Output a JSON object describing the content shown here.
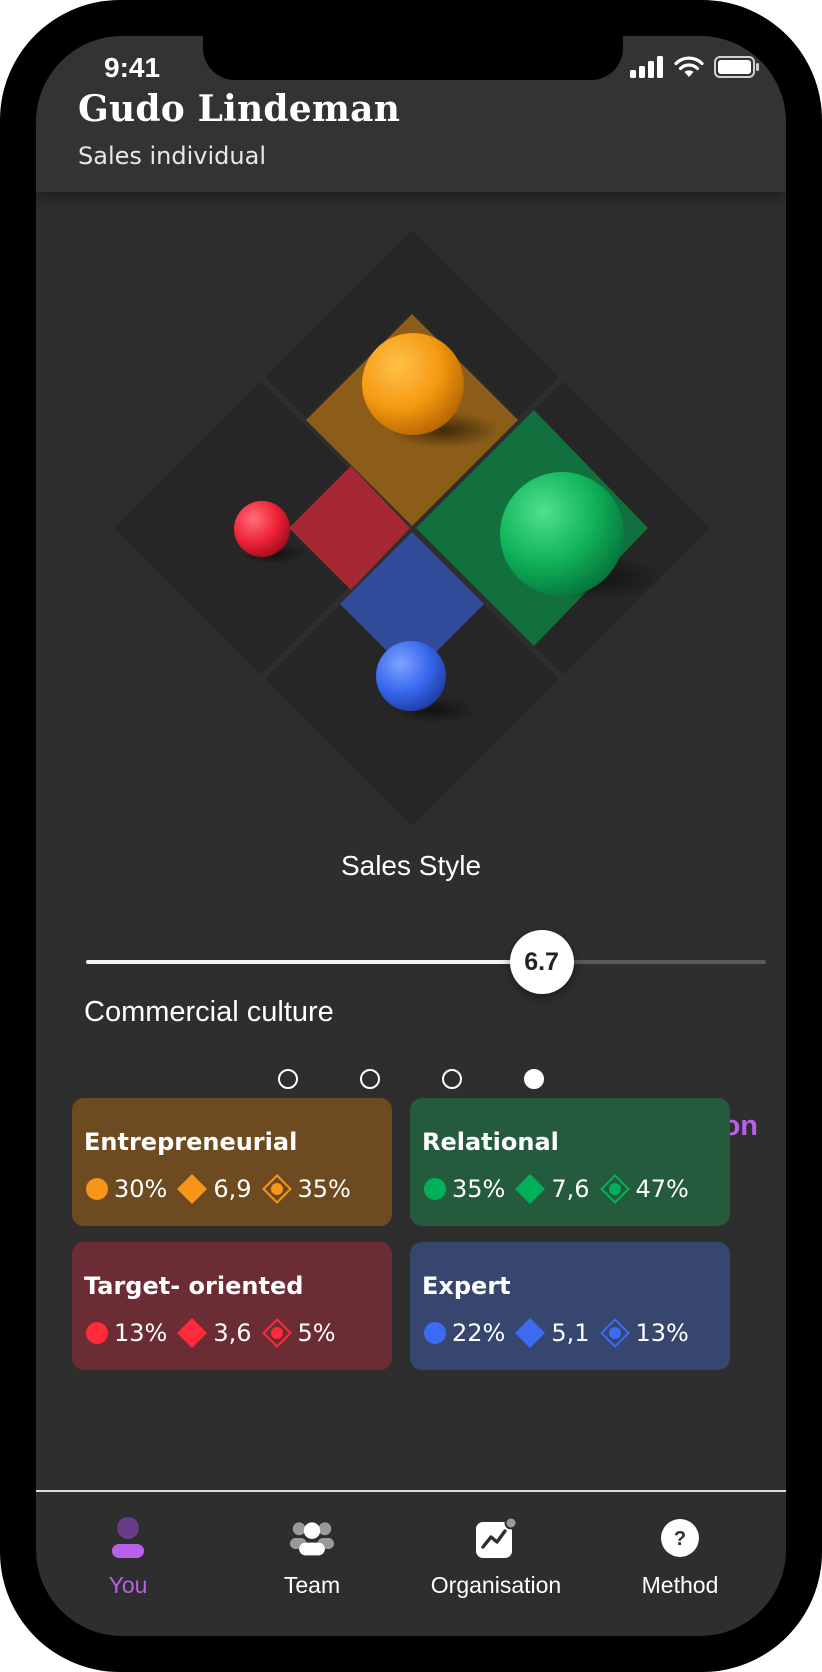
{
  "status_bar": {
    "time": "9:41"
  },
  "header": {
    "name": "Gudo Lindeman",
    "role": "Sales individual"
  },
  "diagram": {
    "title": "Sales Style"
  },
  "slider": {
    "value": 6.7,
    "value_label": "6.7",
    "max": 10,
    "caption": "Commercial culture"
  },
  "pager": {
    "count": 4,
    "active_index": 3
  },
  "explanation_link": "Explanation",
  "colors": {
    "accent": "#b760e9",
    "entrepreneurial": "#f6951a",
    "relational": "#00b15a",
    "target_oriented": "#ff2a3a",
    "expert": "#3c6cf0"
  },
  "cards": [
    {
      "title": "Entrepreneurial",
      "stat1": "30%",
      "stat2": "6,9",
      "stat3": "35%",
      "icon1": "circle-icon",
      "icon2": "diamond-icon",
      "icon3": "diamond-target-icon"
    },
    {
      "title": "Relational",
      "stat1": "35%",
      "stat2": "7,6",
      "stat3": "47%",
      "icon1": "circle-icon",
      "icon2": "diamond-icon",
      "icon3": "diamond-target-icon"
    },
    {
      "title": "Target- oriented",
      "stat1": "13%",
      "stat2": "3,6",
      "stat3": "5%",
      "icon1": "circle-icon",
      "icon2": "diamond-icon",
      "icon3": "diamond-target-icon"
    },
    {
      "title": "Expert",
      "stat1": "22%",
      "stat2": "5,1",
      "stat3": "13%",
      "icon1": "circle-icon",
      "icon2": "diamond-icon",
      "icon3": "diamond-target-icon"
    }
  ],
  "tabs": [
    {
      "label": "You",
      "icon": "person-icon",
      "active": true
    },
    {
      "label": "Team",
      "icon": "team-icon",
      "active": false
    },
    {
      "label": "Organisation",
      "icon": "chart-icon",
      "active": false
    },
    {
      "label": "Method",
      "icon": "question-icon",
      "active": false
    }
  ]
}
